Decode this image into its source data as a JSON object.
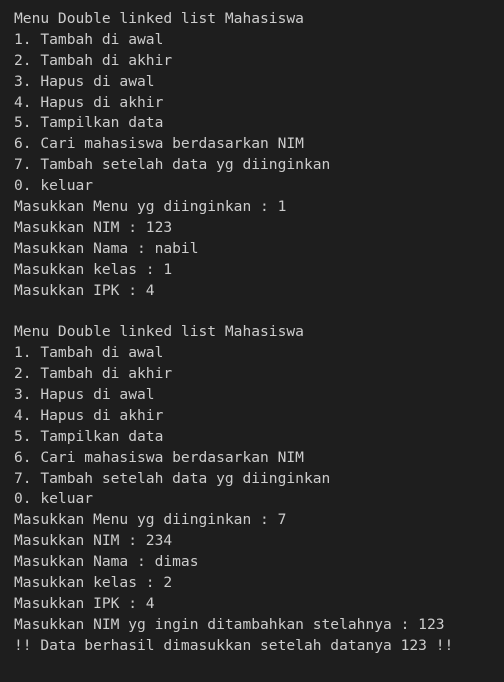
{
  "terminal": {
    "background": "#1e1e1e",
    "text_color": "#cccccc",
    "lines": [
      "Menu Double linked list Mahasiswa",
      "1. Tambah di awal",
      "2. Tambah di akhir",
      "3. Hapus di awal",
      "4. Hapus di akhir",
      "5. Tampilkan data",
      "6. Cari mahasiswa berdasarkan NIM",
      "7. Tambah setelah data yg diinginkan",
      "0. keluar",
      "Masukkan Menu yg diinginkan : 1",
      "Masukkan NIM : 123",
      "Masukkan Nama : nabil",
      "Masukkan kelas : 1",
      "Masukkan IPK : 4",
      "",
      "Menu Double linked list Mahasiswa",
      "1. Tambah di awal",
      "2. Tambah di akhir",
      "3. Hapus di awal",
      "4. Hapus di akhir",
      "5. Tampilkan data",
      "6. Cari mahasiswa berdasarkan NIM",
      "7. Tambah setelah data yg diinginkan",
      "0. keluar",
      "Masukkan Menu yg diinginkan : 7",
      "Masukkan NIM : 234",
      "Masukkan Nama : dimas",
      "Masukkan kelas : 2",
      "Masukkan IPK : 4",
      "Masukkan NIM yg ingin ditambahkan stelahnya : 123",
      "!! Data berhasil dimasukkan setelah datanya 123 !!"
    ]
  }
}
